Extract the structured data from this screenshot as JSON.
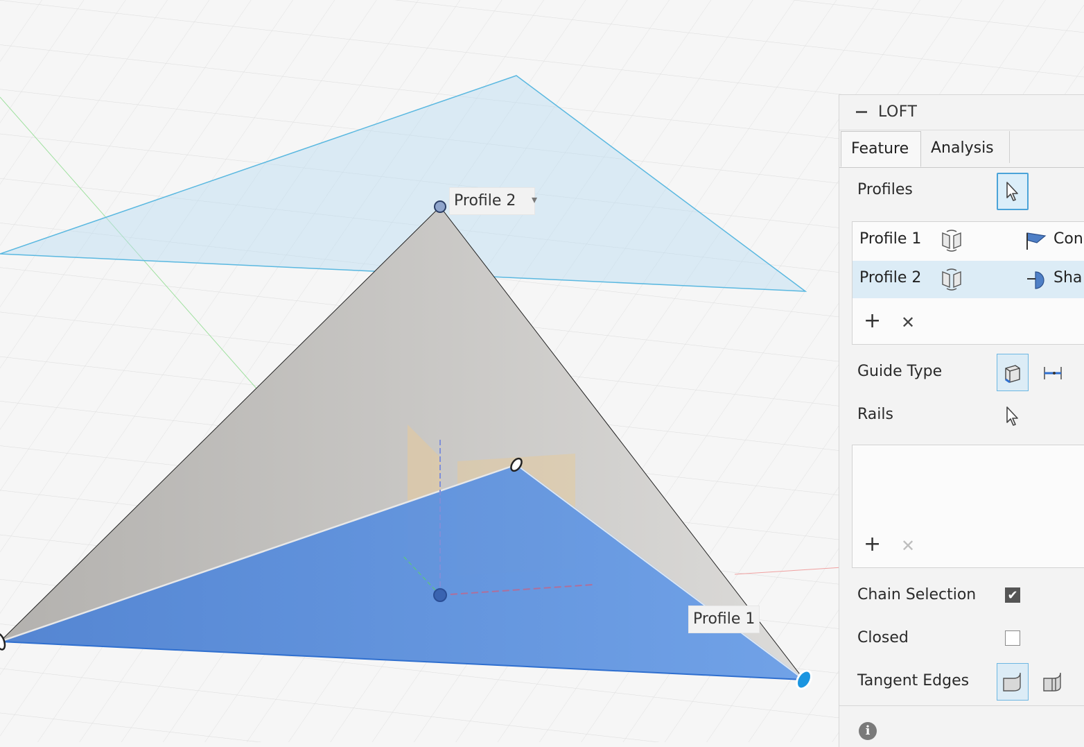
{
  "canvas": {
    "profile2_label": "Profile 2",
    "profile1_label": "Profile 1",
    "dropdown_glyph": "▾",
    "colors": {
      "loft_face": "#c4c2bf",
      "profile1_fill": "#5c8fdc",
      "profile2_plane": "#b9dcf2",
      "profile2_edge": "#5ab8e0"
    }
  },
  "panel": {
    "title": "LOFT",
    "tabs": [
      {
        "label": "Feature"
      },
      {
        "label": "Analysis"
      }
    ],
    "profiles_label": "Profiles",
    "profiles_list": [
      {
        "name": "Profile 1",
        "condition": "Con"
      },
      {
        "name": "Profile 2",
        "condition": "Sha"
      }
    ],
    "add_glyph": "+",
    "remove_glyph": "✕",
    "guide_type_label": "Guide Type",
    "rails_label": "Rails",
    "chain_selection_label": "Chain Selection",
    "chain_selection_checked": true,
    "check_glyph": "✔",
    "closed_label": "Closed",
    "closed_checked": false,
    "tangent_edges_label": "Tangent Edges",
    "info_glyph": "i"
  }
}
